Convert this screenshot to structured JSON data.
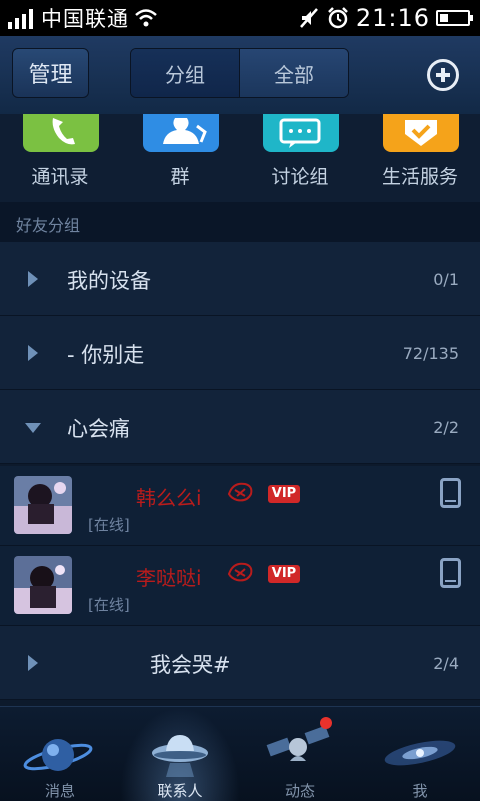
{
  "status_bar": {
    "carrier": "中国联通",
    "time": "21:16"
  },
  "header": {
    "manage_label": "管理",
    "tabs": [
      "分组",
      "全部"
    ]
  },
  "quick_actions": [
    {
      "label": "通讯录",
      "color": "#7bc142",
      "icon": "phone-icon"
    },
    {
      "label": "群",
      "color": "#2f8de4",
      "icon": "group-icon"
    },
    {
      "label": "讨论组",
      "color": "#1fb6c8",
      "icon": "chat-bubble-icon"
    },
    {
      "label": "生活服务",
      "color": "#f5a31a",
      "icon": "service-icon"
    }
  ],
  "section_title": "好友分组",
  "groups": [
    {
      "name": "我的设备",
      "count": "0/1"
    },
    {
      "name": "- 你别走",
      "count": "72/135"
    },
    {
      "name": "心会痛",
      "count": "2/2"
    },
    {
      "name": "我会哭#",
      "count": "2/4"
    }
  ],
  "friends": [
    {
      "name": "韩么么i",
      "badge": "VIP",
      "status": "[在线]"
    },
    {
      "name": "李哒哒i",
      "badge": "VIP",
      "status": "[在线]"
    }
  ],
  "tabs": [
    {
      "label": "消息"
    },
    {
      "label": "联系人"
    },
    {
      "label": "动态"
    },
    {
      "label": "我"
    }
  ]
}
